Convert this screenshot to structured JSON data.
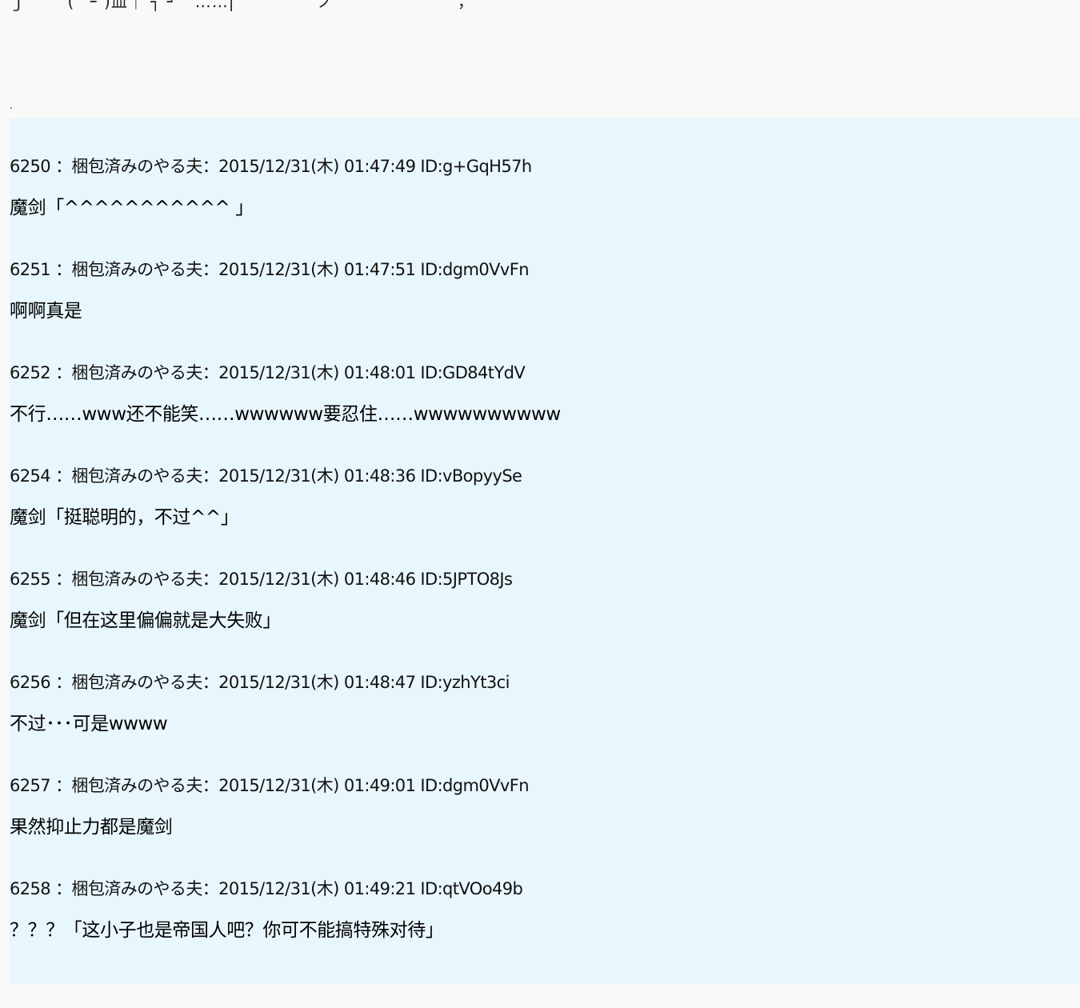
{
  "top_partial_text": "ｊ       (ﾟ ｰ )皿｜ ┐ ┘   ……|              ノ                     ，",
  "top_dot": ".",
  "posts": [
    {
      "header": "6250 ：梱包済みのやる夫：2015/12/31(木) 01:47:49 ID:g+GqH57h",
      "body": "魔剑「^^^^^^^^^^^ 」"
    },
    {
      "header": "6251 ：梱包済みのやる夫：2015/12/31(木) 01:47:51 ID:dgm0VvFn",
      "body": "啊啊真是"
    },
    {
      "header": "6252 ：梱包済みのやる夫：2015/12/31(木) 01:48:01 ID:GD84tYdV",
      "body": "不行……www还不能笑……wwwwww要忍住……wwwwwwwwww"
    },
    {
      "header": "6254 ：梱包済みのやる夫：2015/12/31(木) 01:48:36 ID:vBopyySe",
      "body": "魔剑「挺聪明的，不过^^」"
    },
    {
      "header": "6255 ：梱包済みのやる夫：2015/12/31(木) 01:48:46 ID:5JPTO8Js",
      "body": "魔剑「但在这里偏偏就是大失败」"
    },
    {
      "header": "6256 ：梱包済みのやる夫：2015/12/31(木) 01:48:47 ID:yzhYt3ci",
      "body": "不过･･･可是wwww"
    },
    {
      "header": "6257 ：梱包済みのやる夫：2015/12/31(木) 01:49:01 ID:dgm0VvFn",
      "body": "果然抑止力都是魔剑"
    },
    {
      "header": "6258 ：梱包済みのやる夫：2015/12/31(木) 01:49:21 ID:qtVOo49b",
      "body": "？？？「这小子也是帝国人吧？你可不能搞特殊对待」"
    }
  ]
}
